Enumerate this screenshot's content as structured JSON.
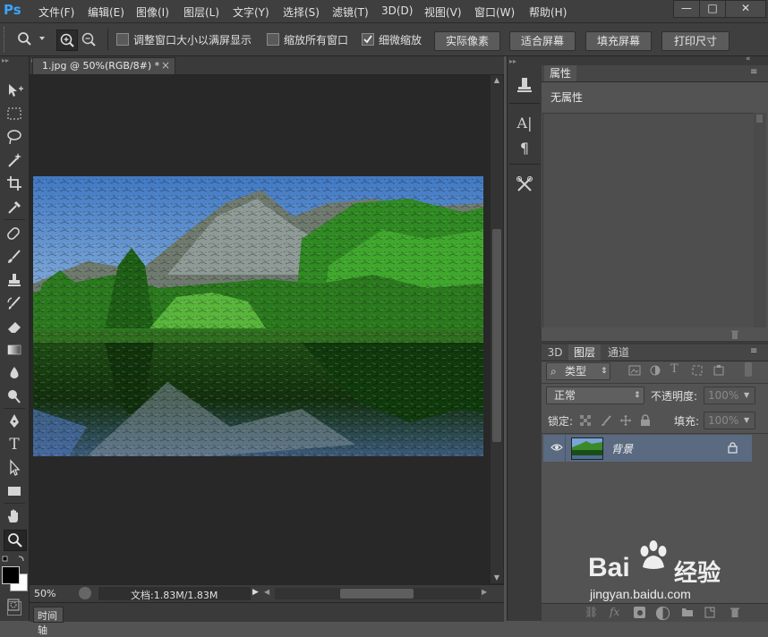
{
  "app": {
    "logo": "Ps"
  },
  "menu": [
    "文件(F)",
    "编辑(E)",
    "图像(I)",
    "图层(L)",
    "文字(Y)",
    "选择(S)",
    "滤镜(T)",
    "3D(D)",
    "视图(V)",
    "窗口(W)",
    "帮助(H)"
  ],
  "window_controls": {
    "minimize": "—",
    "maximize": "□",
    "close": "✕"
  },
  "options": {
    "resize_window_label": "调整窗口大小以满屏显示",
    "zoom_all_label": "缩放所有窗口",
    "scrubby_zoom_label": "细微缩放",
    "resize_window_checked": false,
    "zoom_all_checked": false,
    "scrubby_zoom_checked": true,
    "actual_pixels": "实际像素",
    "fit_screen": "适合屏幕",
    "fill_screen": "填充屏幕",
    "print_size": "打印尺寸"
  },
  "document": {
    "tab_title": "1.jpg @ 50%(RGB/8#) *",
    "zoom": "50%",
    "doc_info": "文档:1.83M/1.83M"
  },
  "timeline": {
    "label": "时间轴"
  },
  "properties": {
    "tab": "属性",
    "empty_text": "无属性"
  },
  "layers": {
    "tabs": [
      "3D",
      "图层",
      "通道"
    ],
    "active_tab": "图层",
    "filter_kind": "类型",
    "blend_mode": "正常",
    "opacity_label": "不透明度:",
    "opacity_value": "100%",
    "lock_label": "锁定:",
    "fill_label": "填充:",
    "fill_value": "100%",
    "items": [
      {
        "name": "背景",
        "visible": true,
        "locked": true
      }
    ]
  },
  "watermark": {
    "brand": "Bai",
    "brand2": "经验",
    "url": "jingyan.baidu.com"
  },
  "colors": {
    "chrome": "#3f3f3f",
    "panel": "#535353",
    "canvas_bg": "#282828",
    "logo_blue": "#39a4ff",
    "layer_selected": "#596a81"
  }
}
